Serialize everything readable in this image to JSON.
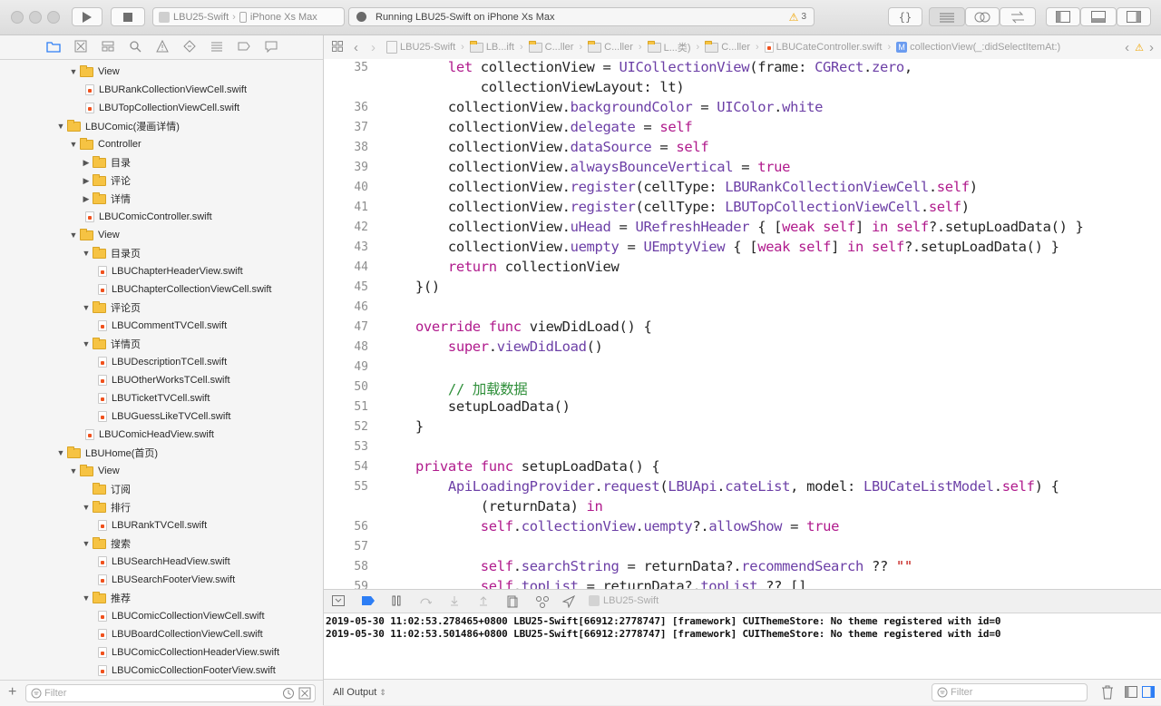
{
  "toolbar": {
    "scheme_target": "LBU25-Swift",
    "scheme_device": "iPhone Xs Max",
    "status_text": "Running LBU25-Swift on iPhone Xs Max",
    "warning_count": "3"
  },
  "navigator": {
    "tree": [
      {
        "label": "View",
        "kind": "folder",
        "depth": 1,
        "expanded": true
      },
      {
        "label": "LBURankCollectionViewCell.swift",
        "kind": "file",
        "depth": 2
      },
      {
        "label": "LBUTopCollectionViewCell.swift",
        "kind": "file",
        "depth": 2
      },
      {
        "label": "LBUComic(漫画详情)",
        "kind": "folder",
        "depth": 0,
        "expanded": true
      },
      {
        "label": "Controller",
        "kind": "folder",
        "depth": 1,
        "expanded": true
      },
      {
        "label": "目录",
        "kind": "folder",
        "depth": 2,
        "expanded": false
      },
      {
        "label": "评论",
        "kind": "folder",
        "depth": 2,
        "expanded": false
      },
      {
        "label": "详情",
        "kind": "folder",
        "depth": 2,
        "expanded": false
      },
      {
        "label": "LBUComicController.swift",
        "kind": "file",
        "depth": 2
      },
      {
        "label": "View",
        "kind": "folder",
        "depth": 1,
        "expanded": true
      },
      {
        "label": "目录页",
        "kind": "folder",
        "depth": 2,
        "expanded": true
      },
      {
        "label": "LBUChapterHeaderView.swift",
        "kind": "file",
        "depth": 3
      },
      {
        "label": "LBUChapterCollectionViewCell.swift",
        "kind": "file",
        "depth": 3
      },
      {
        "label": "评论页",
        "kind": "folder",
        "depth": 2,
        "expanded": true
      },
      {
        "label": "LBUCommentTVCell.swift",
        "kind": "file",
        "depth": 3
      },
      {
        "label": "详情页",
        "kind": "folder",
        "depth": 2,
        "expanded": true
      },
      {
        "label": "LBUDescriptionTCell.swift",
        "kind": "file",
        "depth": 3
      },
      {
        "label": "LBUOtherWorksTCell.swift",
        "kind": "file",
        "depth": 3
      },
      {
        "label": "LBUTicketTVCell.swift",
        "kind": "file",
        "depth": 3
      },
      {
        "label": "LBUGuessLikeTVCell.swift",
        "kind": "file",
        "depth": 3
      },
      {
        "label": "LBUComicHeadView.swift",
        "kind": "file",
        "depth": 2
      },
      {
        "label": "LBUHome(首页)",
        "kind": "folder",
        "depth": 0,
        "expanded": true
      },
      {
        "label": "View",
        "kind": "folder",
        "depth": 1,
        "expanded": true
      },
      {
        "label": "订阅",
        "kind": "folder",
        "depth": 2,
        "expanded": false,
        "no_tri": true
      },
      {
        "label": "排行",
        "kind": "folder",
        "depth": 2,
        "expanded": true
      },
      {
        "label": "LBURankTVCell.swift",
        "kind": "file",
        "depth": 3
      },
      {
        "label": "搜索",
        "kind": "folder",
        "depth": 2,
        "expanded": true
      },
      {
        "label": "LBUSearchHeadView.swift",
        "kind": "file",
        "depth": 3
      },
      {
        "label": "LBUSearchFooterView.swift",
        "kind": "file",
        "depth": 3
      },
      {
        "label": "推荐",
        "kind": "folder",
        "depth": 2,
        "expanded": true
      },
      {
        "label": "LBUComicCollectionViewCell.swift",
        "kind": "file",
        "depth": 3
      },
      {
        "label": "LBUBoardCollectionViewCell.swift",
        "kind": "file",
        "depth": 3
      },
      {
        "label": "LBUComicCollectionHeaderView.swift",
        "kind": "file",
        "depth": 3
      },
      {
        "label": "LBUComicCollectionFooterView.swift",
        "kind": "file",
        "depth": 3
      }
    ],
    "filter_placeholder": "Filter"
  },
  "jumpbar": {
    "items": [
      "LBU25-Swift",
      "LB...ift",
      "C...ller",
      "C...ller",
      "L...类)",
      "C...ller",
      "LBUCateController.swift",
      "collectionView(_:didSelectItemAt:)"
    ]
  },
  "editor": {
    "lines": [
      {
        "n": "35",
        "t": "        let collectionView = UICollectionView(frame: CGRect.zero,"
      },
      {
        "n": "",
        "t": "            collectionViewLayout: lt)"
      },
      {
        "n": "36",
        "t": "        collectionView.backgroundColor = UIColor.white"
      },
      {
        "n": "37",
        "t": "        collectionView.delegate = self"
      },
      {
        "n": "38",
        "t": "        collectionView.dataSource = self"
      },
      {
        "n": "39",
        "t": "        collectionView.alwaysBounceVertical = true"
      },
      {
        "n": "40",
        "t": "        collectionView.register(cellType: LBURankCollectionViewCell.self)"
      },
      {
        "n": "41",
        "t": "        collectionView.register(cellType: LBUTopCollectionViewCell.self)"
      },
      {
        "n": "42",
        "t": "        collectionView.uHead = URefreshHeader { [weak self] in self?.setupLoadData() }"
      },
      {
        "n": "43",
        "t": "        collectionView.uempty = UEmptyView { [weak self] in self?.setupLoadData() }"
      },
      {
        "n": "44",
        "t": "        return collectionView"
      },
      {
        "n": "45",
        "t": "    }()"
      },
      {
        "n": "46",
        "t": ""
      },
      {
        "n": "47",
        "t": "    override func viewDidLoad() {"
      },
      {
        "n": "48",
        "t": "        super.viewDidLoad()"
      },
      {
        "n": "49",
        "t": ""
      },
      {
        "n": "50",
        "t": "        // 加载数据"
      },
      {
        "n": "51",
        "t": "        setupLoadData()"
      },
      {
        "n": "52",
        "t": "    }"
      },
      {
        "n": "53",
        "t": ""
      },
      {
        "n": "54",
        "t": "    private func setupLoadData() {"
      },
      {
        "n": "55",
        "t": "        ApiLoadingProvider.request(LBUApi.cateList, model: LBUCateListModel.self) {"
      },
      {
        "n": "",
        "t": "            (returnData) in"
      },
      {
        "n": "56",
        "t": "            self.collectionView.uempty?.allowShow = true"
      },
      {
        "n": "57",
        "t": ""
      },
      {
        "n": "58",
        "t": "            self.searchString = returnData?.recommendSearch ?? \"\""
      },
      {
        "n": "59",
        "t": "            self.topList = returnData?.topList ?? []"
      }
    ]
  },
  "debug": {
    "target_label": "LBU25-Swift",
    "log_lines": [
      "2019-05-30 11:02:53.278465+0800 LBU25-Swift[66912:2778747] [framework] CUIThemeStore: No theme registered with id=0",
      "2019-05-30 11:02:53.501486+0800 LBU25-Swift[66912:2778747] [framework] CUIThemeStore: No theme registered with id=0"
    ],
    "output_selector": "All Output",
    "filter_placeholder": "Filter"
  }
}
